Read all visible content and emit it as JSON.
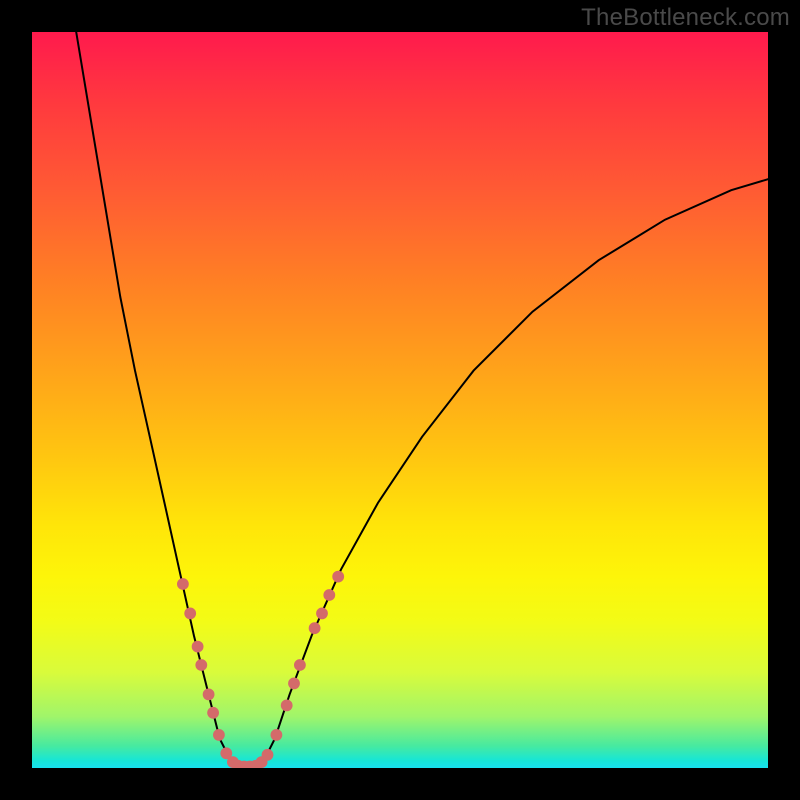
{
  "watermark": "TheBottleneck.com",
  "colors": {
    "dot": "#d46a6a",
    "curve": "#000000",
    "frame": "#000000",
    "gradient_top": "#ff1a4d",
    "gradient_bottom": "#18e1ef"
  },
  "chart_data": {
    "type": "line",
    "title": "",
    "xlabel": "",
    "ylabel": "",
    "xlim": [
      0,
      100
    ],
    "ylim": [
      0,
      100
    ],
    "grid": false,
    "legend": false,
    "curve_points": [
      {
        "x": 6.0,
        "y": 100.0
      },
      {
        "x": 8.0,
        "y": 88.0
      },
      {
        "x": 10.0,
        "y": 76.0
      },
      {
        "x": 12.0,
        "y": 64.0
      },
      {
        "x": 14.0,
        "y": 54.0
      },
      {
        "x": 16.0,
        "y": 45.0
      },
      {
        "x": 18.0,
        "y": 36.0
      },
      {
        "x": 20.0,
        "y": 27.0
      },
      {
        "x": 22.0,
        "y": 18.0
      },
      {
        "x": 24.0,
        "y": 10.0
      },
      {
        "x": 25.5,
        "y": 4.0
      },
      {
        "x": 27.0,
        "y": 1.0
      },
      {
        "x": 28.5,
        "y": 0.0
      },
      {
        "x": 30.0,
        "y": 0.0
      },
      {
        "x": 31.5,
        "y": 1.0
      },
      {
        "x": 33.0,
        "y": 4.0
      },
      {
        "x": 35.0,
        "y": 10.0
      },
      {
        "x": 38.0,
        "y": 18.0
      },
      {
        "x": 42.0,
        "y": 27.0
      },
      {
        "x": 47.0,
        "y": 36.0
      },
      {
        "x": 53.0,
        "y": 45.0
      },
      {
        "x": 60.0,
        "y": 54.0
      },
      {
        "x": 68.0,
        "y": 62.0
      },
      {
        "x": 77.0,
        "y": 69.0
      },
      {
        "x": 86.0,
        "y": 74.5
      },
      {
        "x": 95.0,
        "y": 78.5
      },
      {
        "x": 100.0,
        "y": 80.0
      }
    ],
    "dots": [
      {
        "x": 20.5,
        "y": 25.0
      },
      {
        "x": 21.5,
        "y": 21.0
      },
      {
        "x": 22.5,
        "y": 16.5
      },
      {
        "x": 23.0,
        "y": 14.0
      },
      {
        "x": 24.0,
        "y": 10.0
      },
      {
        "x": 24.6,
        "y": 7.5
      },
      {
        "x": 25.4,
        "y": 4.5
      },
      {
        "x": 26.4,
        "y": 2.0
      },
      {
        "x": 27.3,
        "y": 0.8
      },
      {
        "x": 28.0,
        "y": 0.3
      },
      {
        "x": 28.8,
        "y": 0.2
      },
      {
        "x": 29.6,
        "y": 0.2
      },
      {
        "x": 30.4,
        "y": 0.3
      },
      {
        "x": 31.2,
        "y": 0.8
      },
      {
        "x": 32.0,
        "y": 1.8
      },
      {
        "x": 33.2,
        "y": 4.5
      },
      {
        "x": 34.6,
        "y": 8.5
      },
      {
        "x": 35.6,
        "y": 11.5
      },
      {
        "x": 36.4,
        "y": 14.0
      },
      {
        "x": 38.4,
        "y": 19.0
      },
      {
        "x": 39.4,
        "y": 21.0
      },
      {
        "x": 40.4,
        "y": 23.5
      },
      {
        "x": 41.6,
        "y": 26.0
      }
    ],
    "dot_radius_pct": 0.8
  }
}
